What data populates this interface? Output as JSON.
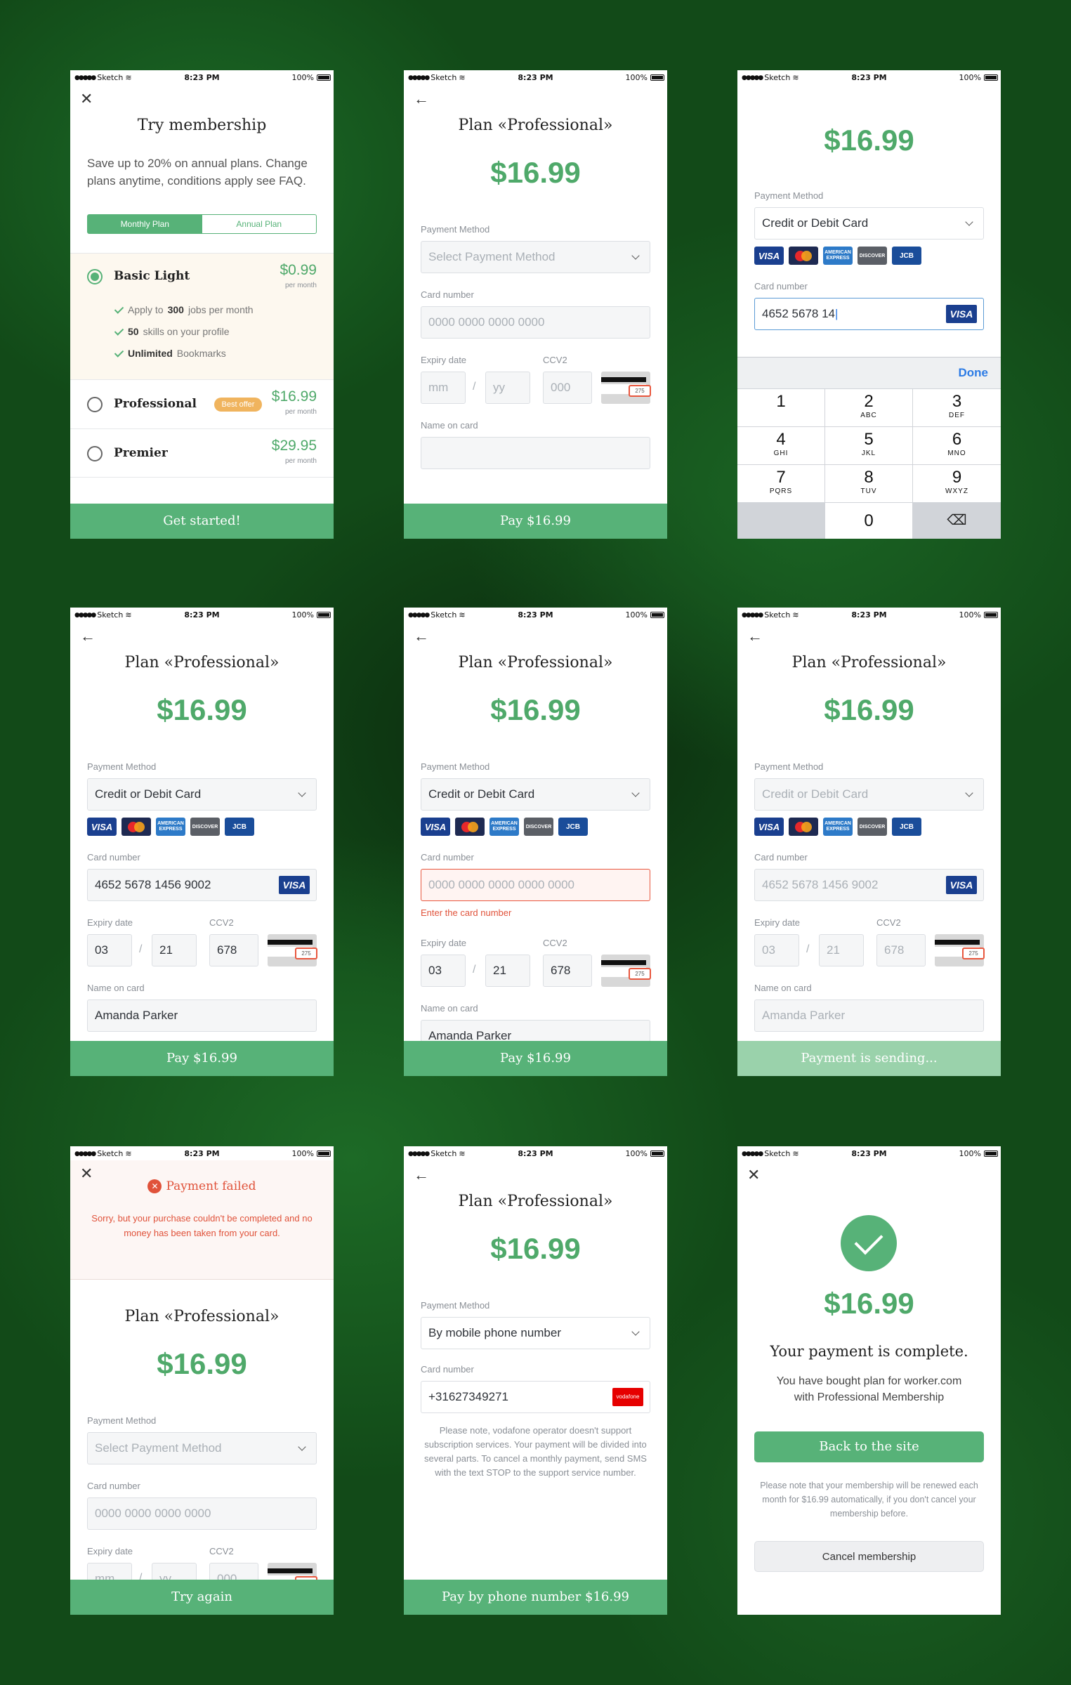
{
  "status": {
    "carrier": "Sketch",
    "time": "8:23 PM",
    "battery": "100%"
  },
  "s1": {
    "title": "Try membership",
    "desc": "Save up to 20% on annual plans. Change plans anytime, conditions apply see FAQ.",
    "tab_monthly": "Monthly Plan",
    "tab_annual": "Annual Plan",
    "plans": [
      {
        "name": "Basic Light",
        "price": "$0.99",
        "per": "per month",
        "selected": true
      },
      {
        "name": "Professional",
        "price": "$16.99",
        "per": "per month",
        "badge": "Best offer"
      },
      {
        "name": "Premier",
        "price": "$29.95",
        "per": "per month"
      }
    ],
    "f1a": "Apply to",
    "f1b": "300",
    "f1c": "jobs per month",
    "f2a": "50",
    "f2b": "skills on your profile",
    "f3a": "Unlimited",
    "f3b": "Bookmarks",
    "cta": "Get started!"
  },
  "common": {
    "plan_title": "Plan «Professional»",
    "price": "$16.99",
    "payment_method": "Payment Method",
    "card_number": "Card number",
    "expiry": "Expiry date",
    "ccv": "CCV2",
    "name_on_card": "Name on card",
    "select_ph": "Select Payment Method",
    "card_ph": "0000 0000 0000 0000",
    "mm_ph": "mm",
    "yy_ph": "yy",
    "ccv_ph": "000",
    "card_type": "Credit or Debit Card",
    "card_full": "4652 5678 1456 9002",
    "mm": "03",
    "yy": "21",
    "ccv_val": "678",
    "name": "Amanda Parker",
    "pay": "Pay $16.99",
    "ccv_img": "275",
    "slash": "/"
  },
  "logos": {
    "visa": "VISA",
    "master": "MasterCard",
    "amex": "AMERICAN EXPRESS",
    "discover": "DISCOVER",
    "jcb": "JCB"
  },
  "s3": {
    "typed": "4652 5678 14",
    "done": "Done",
    "keys": [
      [
        "1",
        ""
      ],
      [
        "2",
        "ABC"
      ],
      [
        "3",
        "DEF"
      ],
      [
        "4",
        "GHI"
      ],
      [
        "5",
        "JKL"
      ],
      [
        "6",
        "MNO"
      ],
      [
        "7",
        "PQRS"
      ],
      [
        "8",
        "TUV"
      ],
      [
        "9",
        "WXYZ"
      ],
      [
        "0",
        ""
      ]
    ]
  },
  "s5": {
    "err_ph": "0000 0000 0000 0000 0000",
    "err": "Enter the card number"
  },
  "s6": {
    "cta": "Payment is sending..."
  },
  "s7": {
    "title": "Payment failed",
    "msg": "Sorry, but your purchase couldn't be completed and no money has been taken from your card.",
    "cta": "Try again"
  },
  "s8": {
    "method": "By mobile phone number",
    "phone": "+31627349271",
    "operator": "vodafone",
    "note": "Please note, vodafone operator doesn't support subscription services. Your payment will be divided into several parts. To cancel a monthly payment, send SMS with the text STOP to the support service number.",
    "cta": "Pay by phone number $16.99"
  },
  "s9": {
    "title": "Your payment is complete.",
    "desc": "You have bought  plan for worker.com with Professional Membership",
    "back": "Back to the site",
    "note": "Please note that your membership will be renewed  each month for $16.99 automatically, if you don't cancel your membership before.",
    "cancel": "Cancel membership"
  },
  "colors": {
    "accent": "#57b278",
    "error": "#e0523a",
    "badge": "#f0b45e"
  }
}
